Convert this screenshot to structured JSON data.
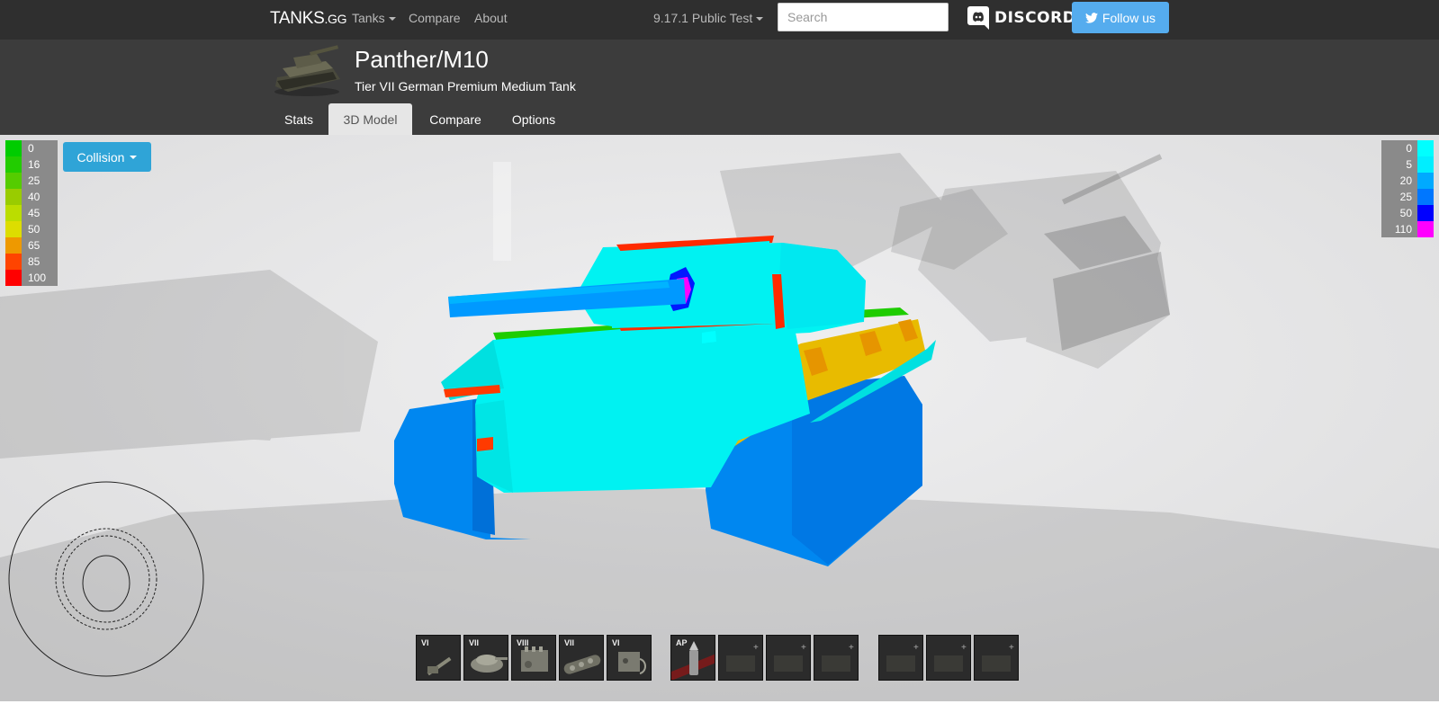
{
  "nav": {
    "brand_main": "TANKS",
    "brand_suffix": ".GG",
    "tanks_label": "Tanks",
    "compare_label": "Compare",
    "about_label": "About",
    "version_label": "9.17.1 Public Test",
    "search_placeholder": "Search",
    "discord_label": "DISCORD",
    "follow_label": "Follow us"
  },
  "tank": {
    "name": "Panther/M10",
    "subtitle": "Tier VII German Premium Medium Tank"
  },
  "tabs": [
    {
      "label": "Stats",
      "active": false
    },
    {
      "label": "3D Model",
      "active": true
    },
    {
      "label": "Compare",
      "active": false
    },
    {
      "label": "Options",
      "active": false
    }
  ],
  "collision_label": "Collision",
  "legend_left": [
    {
      "value": "0",
      "color": "#00cc00"
    },
    {
      "value": "16",
      "color": "#22cc00"
    },
    {
      "value": "25",
      "color": "#55cc00"
    },
    {
      "value": "40",
      "color": "#99cc00"
    },
    {
      "value": "45",
      "color": "#bbdd00"
    },
    {
      "value": "50",
      "color": "#dddd00"
    },
    {
      "value": "65",
      "color": "#ee9900"
    },
    {
      "value": "85",
      "color": "#ff4400"
    },
    {
      "value": "100",
      "color": "#ff0000"
    }
  ],
  "legend_right": [
    {
      "value": "0",
      "color": "#00ffff"
    },
    {
      "value": "5",
      "color": "#00eeff"
    },
    {
      "value": "20",
      "color": "#00aaff"
    },
    {
      "value": "25",
      "color": "#0077ff"
    },
    {
      "value": "50",
      "color": "#0000ff"
    },
    {
      "value": "110",
      "color": "#ff00ff"
    }
  ],
  "modules": [
    {
      "tier": "VI",
      "icon": "gun-module-icon"
    },
    {
      "tier": "VII",
      "icon": "turret-module-icon"
    },
    {
      "tier": "VIII",
      "icon": "engine-module-icon"
    },
    {
      "tier": "VII",
      "icon": "suspension-module-icon"
    },
    {
      "tier": "VI",
      "icon": "radio-module-icon"
    }
  ],
  "shell": {
    "label": "AP",
    "icon": "ap-shell-icon"
  },
  "colors": {
    "navbar": "#2f2f2f",
    "header": "#3c3c3c",
    "accent": "#2fa4d7",
    "twitter": "#55acee",
    "hull_cyan": "#00f2f2",
    "tracks_blue": "#0087f0"
  }
}
